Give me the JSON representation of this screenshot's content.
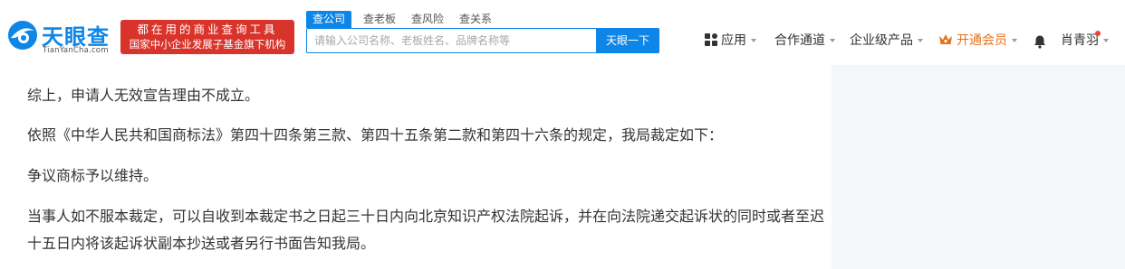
{
  "logo": {
    "name": "天眼查",
    "domain": "TianYanCha.com"
  },
  "ad_banner": {
    "line1": "都在用的商业查询工具",
    "line2": "国家中小企业发展子基金旗下机构"
  },
  "search": {
    "tabs": [
      "查公司",
      "查老板",
      "查风险",
      "查关系"
    ],
    "active_tab": "查公司",
    "placeholder": "请输入公司名称、老板姓名、品牌名称等",
    "button": "天眼一下"
  },
  "nav": {
    "apps": "应用",
    "channels": "合作通道",
    "enterprise": "企业级产品",
    "vip": "开通会员",
    "user": "肖青羽"
  },
  "colors": {
    "brand": "#0d86e7",
    "banner": "#d9342b",
    "vip": "#e8711b"
  },
  "document": {
    "paragraphs": [
      "综上，申请人无效宣告理由不成立。",
      "依照《中华人民共和国商标法》第四十四条第三款、第四十五条第二款和第四十六条的规定，我局裁定如下：",
      "争议商标予以维持。",
      "当事人如不服本裁定，可以自收到本裁定书之日起三十日内向北京知识产权法院起诉，并在向法院递交起诉状的同时或者至迟",
      "十五日内将该起诉状副本抄送或者另行书面告知我局。"
    ]
  }
}
